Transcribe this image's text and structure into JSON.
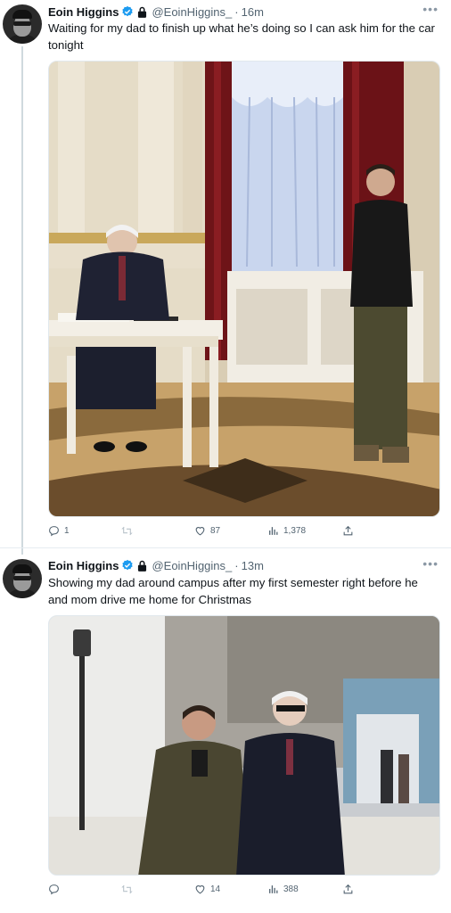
{
  "tweets": [
    {
      "name": "Eoin Higgins",
      "handle": "@EoinHiggins_",
      "dot": "·",
      "time": "16m",
      "text": "Waiting for my dad to finish up what he’s doing so I can ask him for the car tonight",
      "actions": {
        "replies": "1",
        "retweets": "",
        "likes": "87",
        "views": "1,378"
      }
    },
    {
      "name": "Eoin Higgins",
      "handle": "@EoinHiggins_",
      "dot": "·",
      "time": "13m",
      "text": "Showing my dad around campus after my first semester right before he and mom drive me home for Christmas",
      "actions": {
        "replies": "",
        "retweets": "",
        "likes": "14",
        "views": "388"
      }
    }
  ],
  "colors": {
    "text": "#0f1419",
    "secondary": "#536471",
    "verified": "#1d9bf0",
    "divider": "#e6ecf0"
  }
}
